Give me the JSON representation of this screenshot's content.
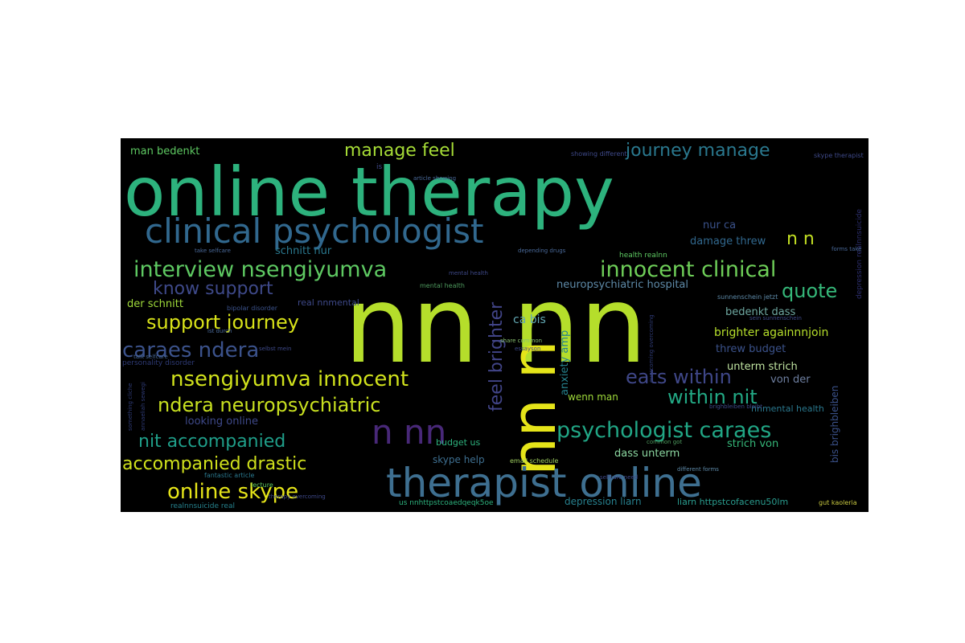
{
  "wordcloud": {
    "background": "#000000",
    "words": [
      {
        "text": "online therapy",
        "color": "#2db27d"
      },
      {
        "text": "clinical psychologist",
        "color": "#31688e"
      },
      {
        "text": "nn nn",
        "color": "#b5de2b"
      },
      {
        "text": "nn n",
        "color": "#e5e419"
      },
      {
        "text": "therapist online",
        "color": "#3e6f90"
      },
      {
        "text": "interview nsengiyumva",
        "color": "#5ec962"
      },
      {
        "text": "innocent clinical",
        "color": "#6ece58"
      },
      {
        "text": "psychologist caraes",
        "color": "#21a685"
      },
      {
        "text": "nsengiyumva innocent",
        "color": "#d0e11c"
      },
      {
        "text": "ndera neuropsychiatric",
        "color": "#c8e020"
      },
      {
        "text": "caraes ndera",
        "color": "#3b528b"
      },
      {
        "text": "support journey",
        "color": "#d8e219"
      },
      {
        "text": "n nn",
        "color": "#482878"
      },
      {
        "text": "accompanied drastic",
        "color": "#d0e11c"
      },
      {
        "text": "online skype",
        "color": "#e5e419"
      },
      {
        "text": "within nit",
        "color": "#22a884"
      },
      {
        "text": "eats within",
        "color": "#3f4788"
      },
      {
        "text": "nit accompanied",
        "color": "#1f9e89"
      },
      {
        "text": "manage feel",
        "color": "#a5db36"
      },
      {
        "text": "journey manage",
        "color": "#2a788e"
      },
      {
        "text": "know support",
        "color": "#3e4989"
      },
      {
        "text": "quote",
        "color": "#35b779"
      },
      {
        "text": "n n",
        "color": "#c2df23"
      },
      {
        "text": "feel brighter",
        "color": "#414487"
      },
      {
        "text": "man bedenkt",
        "color": "#5ec962"
      },
      {
        "text": "nur ca",
        "color": "#3b528b"
      },
      {
        "text": "damage threw",
        "color": "#31688e"
      },
      {
        "text": "schnitt nur",
        "color": "#2a788e"
      },
      {
        "text": "neuropsychiatric hospital",
        "color": "#5e8aa8"
      },
      {
        "text": "der schnitt",
        "color": "#9fda3a"
      },
      {
        "text": "real nnmental",
        "color": "#3e4989"
      },
      {
        "text": "bedenkt dass",
        "color": "#6ea7a0"
      },
      {
        "text": "brighter againnnjoin",
        "color": "#b5de2b"
      },
      {
        "text": "ca bis",
        "color": "#63a8b4"
      },
      {
        "text": "threw budget",
        "color": "#3b528b"
      },
      {
        "text": "anxiety amp",
        "color": "#26828e"
      },
      {
        "text": "unterm strich",
        "color": "#bfe3a0"
      },
      {
        "text": "von der",
        "color": "#6e7fa0"
      },
      {
        "text": "wenn man",
        "color": "#9fda3a"
      },
      {
        "text": "nnmental health",
        "color": "#2a788e"
      },
      {
        "text": "looking online",
        "color": "#3e4989"
      },
      {
        "text": "strich von",
        "color": "#35b779"
      },
      {
        "text": "skype help",
        "color": "#3e6f90"
      },
      {
        "text": "dass unterm",
        "color": "#8bd6a0"
      },
      {
        "text": "bis brighbleiben",
        "color": "#3b528b"
      },
      {
        "text": "budget us",
        "color": "#2db27d"
      },
      {
        "text": "health realnn",
        "color": "#5ec962"
      },
      {
        "text": "depression liarn",
        "color": "#27808e"
      },
      {
        "text": "liarn httpstcofacenu50lm",
        "color": "#2a9d8f"
      },
      {
        "text": "us nnhttpstcoaedqeqk5oe",
        "color": "#2db27d"
      },
      {
        "text": "realnnsuicide real",
        "color": "#26828e"
      },
      {
        "text": "personality disorder",
        "color": "#2e3a74"
      },
      {
        "text": "bipolar disorder",
        "color": "#3b528b"
      },
      {
        "text": "depression realnnsuicide",
        "color": "#2d2f6e"
      },
      {
        "text": "mental health",
        "color": "#4e9a5e"
      },
      {
        "text": "share common",
        "color": "#88c070"
      },
      {
        "text": "email schedule",
        "color": "#a0d060"
      },
      {
        "text": "fantastic article",
        "color": "#2a788e"
      },
      {
        "text": "sunnenschein jetzt",
        "color": "#5e8aa8"
      },
      {
        "text": "article showing",
        "color": "#4a6a9a"
      },
      {
        "text": "showing different",
        "color": "#3e4989"
      },
      {
        "text": "depending drugs",
        "color": "#4a6a9a"
      },
      {
        "text": "skype therapist",
        "color": "#3e4989"
      },
      {
        "text": "take selfcare",
        "color": "#4a6a9a"
      },
      {
        "text": "forms take",
        "color": "#4a6a9a"
      },
      {
        "text": "essayson",
        "color": "#3e4989"
      },
      {
        "text": "common got",
        "color": "#4e9a5e"
      },
      {
        "text": "different forms",
        "color": "#5e8aa8"
      },
      {
        "text": "gut kaoleria",
        "color": "#c8c840"
      },
      {
        "text": "selbst mein",
        "color": "#3e4989"
      },
      {
        "text": "lecture",
        "color": "#5ec962"
      },
      {
        "text": "therapy overcoming",
        "color": "#3e4989"
      },
      {
        "text": "talk selfcare",
        "color": "#4a6a9a"
      },
      {
        "text": "ist durch",
        "color": "#4a6a9a"
      },
      {
        "text": "sein sunnenschein",
        "color": "#3e4989"
      },
      {
        "text": "selfcare need",
        "color": "#3e4989"
      },
      {
        "text": "brighbleiben bleibt",
        "color": "#3e4989"
      },
      {
        "text": "overcoming overcoming",
        "color": "#2e3a74"
      },
      {
        "text": "something cliche",
        "color": "#2e3a74"
      },
      {
        "text": "is",
        "color": "#3e4989"
      },
      {
        "text": "mental health",
        "color": "#3e4989"
      },
      {
        "text": "annaeliah sewegi",
        "color": "#2e3a74"
      }
    ]
  }
}
